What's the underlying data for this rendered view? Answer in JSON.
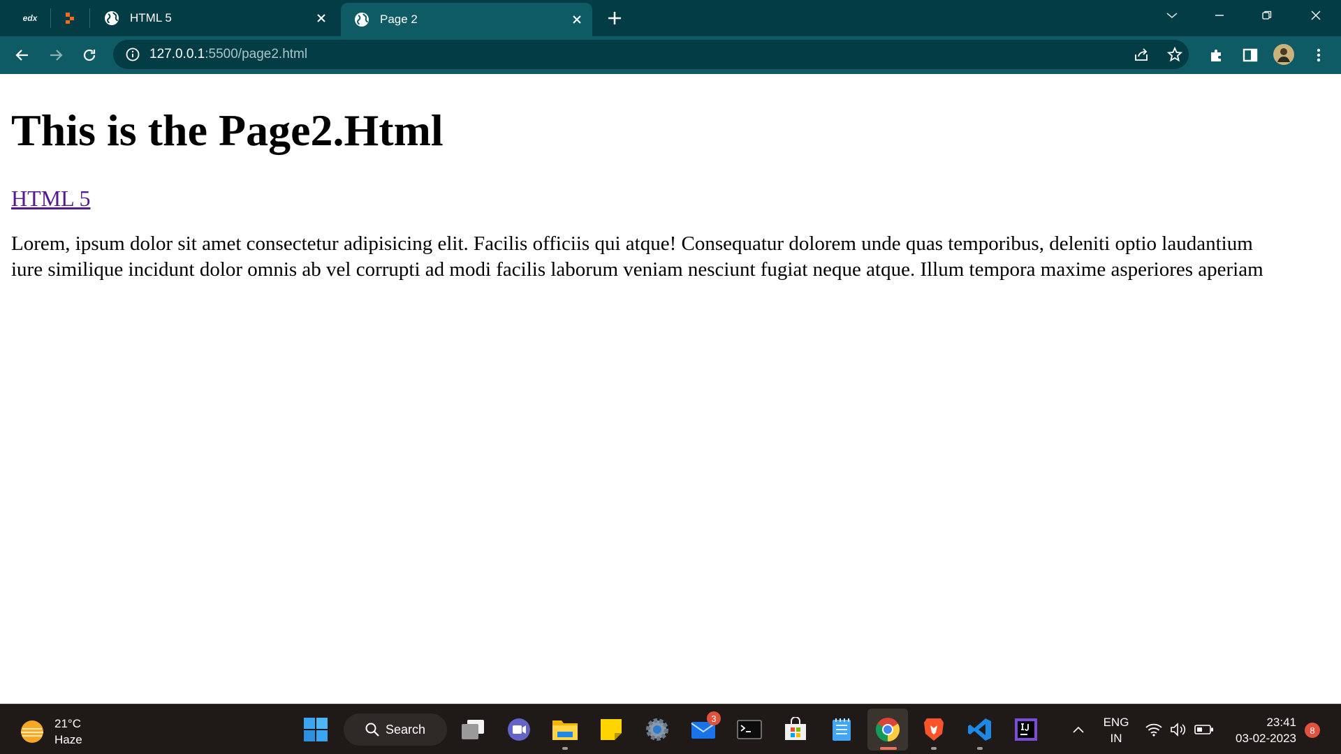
{
  "browser": {
    "pinned_tab_label": "edx",
    "tabs": [
      {
        "title": "HTML 5",
        "active": false
      },
      {
        "title": "Page 2",
        "active": true
      }
    ],
    "url": {
      "host": "127.0.0.1",
      "path": ":5500/page2.html"
    }
  },
  "page": {
    "heading": "This is the Page2.Html",
    "link_text": "HTML 5",
    "paragraph_line1": "Lorem, ipsum dolor sit amet consectetur adipisicing elit. Facilis officiis qui atque! Consequatur dolorem unde quas temporibus, deleniti optio laudantium",
    "paragraph_line2": "iure similique incidunt dolor omnis ab vel corrupti ad modi facilis laborum veniam nesciunt fugiat neque atque. Illum tempora maxime asperiores aperiam"
  },
  "taskbar": {
    "weather": {
      "temp": "21°C",
      "condition": "Haze"
    },
    "search_label": "Search",
    "mail_badge": "3",
    "lang_primary": "ENG",
    "lang_secondary": "IN",
    "time": "23:41",
    "date": "03-02-2023",
    "notification_count": "8"
  },
  "colors": {
    "tabbar": "#033c45",
    "toolbar": "#0e5b65",
    "taskbar": "#1f1a17",
    "visited_link": "#551a8b"
  }
}
